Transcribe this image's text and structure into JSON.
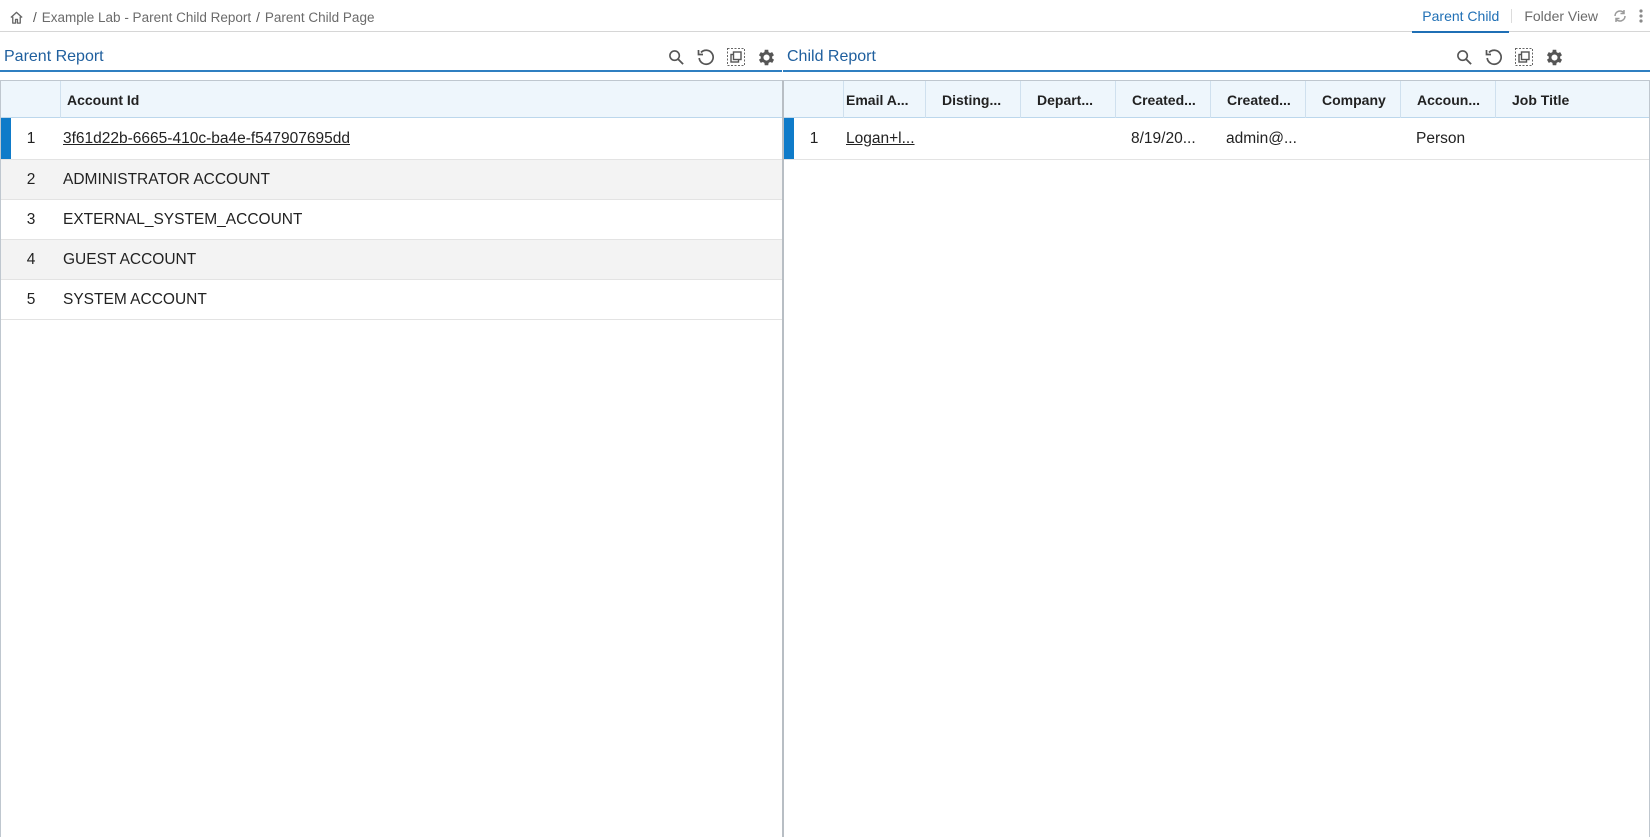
{
  "breadcrumb": {
    "items": [
      "Example Lab - Parent Child Report",
      "Parent Child Page"
    ],
    "separator": "/"
  },
  "tabs": [
    {
      "label": "Parent Child",
      "active": true
    },
    {
      "label": "Folder View",
      "active": false
    }
  ],
  "parent": {
    "title": "Parent Report",
    "column_header": "Account Id",
    "rows": [
      {
        "num": "1",
        "value": "3f61d22b-6665-410c-ba4e-f547907695dd",
        "selected": true
      },
      {
        "num": "2",
        "value": "ADMINISTRATOR ACCOUNT"
      },
      {
        "num": "3",
        "value": "EXTERNAL_SYSTEM_ACCOUNT"
      },
      {
        "num": "4",
        "value": "GUEST ACCOUNT"
      },
      {
        "num": "5",
        "value": "SYSTEM ACCOUNT"
      }
    ]
  },
  "child": {
    "title": "Child Report",
    "columns": [
      "Email A...",
      "Disting...",
      "Depart...",
      "Created...",
      "Created...",
      "Company",
      "Accoun...",
      "Job Title"
    ],
    "rows": [
      {
        "num": "1",
        "cells": [
          "Logan+l...",
          "",
          "",
          "8/19/20...",
          "admin@...",
          "",
          "Person",
          ""
        ]
      }
    ]
  },
  "colors": {
    "accent": "#1f6fb5",
    "selection_marker": "#0f7bc9",
    "header_bg": "#eef6fc"
  },
  "icons": [
    "home-icon",
    "search-icon",
    "refresh-icon",
    "copy-icon",
    "gear-icon",
    "sync-icon",
    "more-vertical-icon"
  ]
}
